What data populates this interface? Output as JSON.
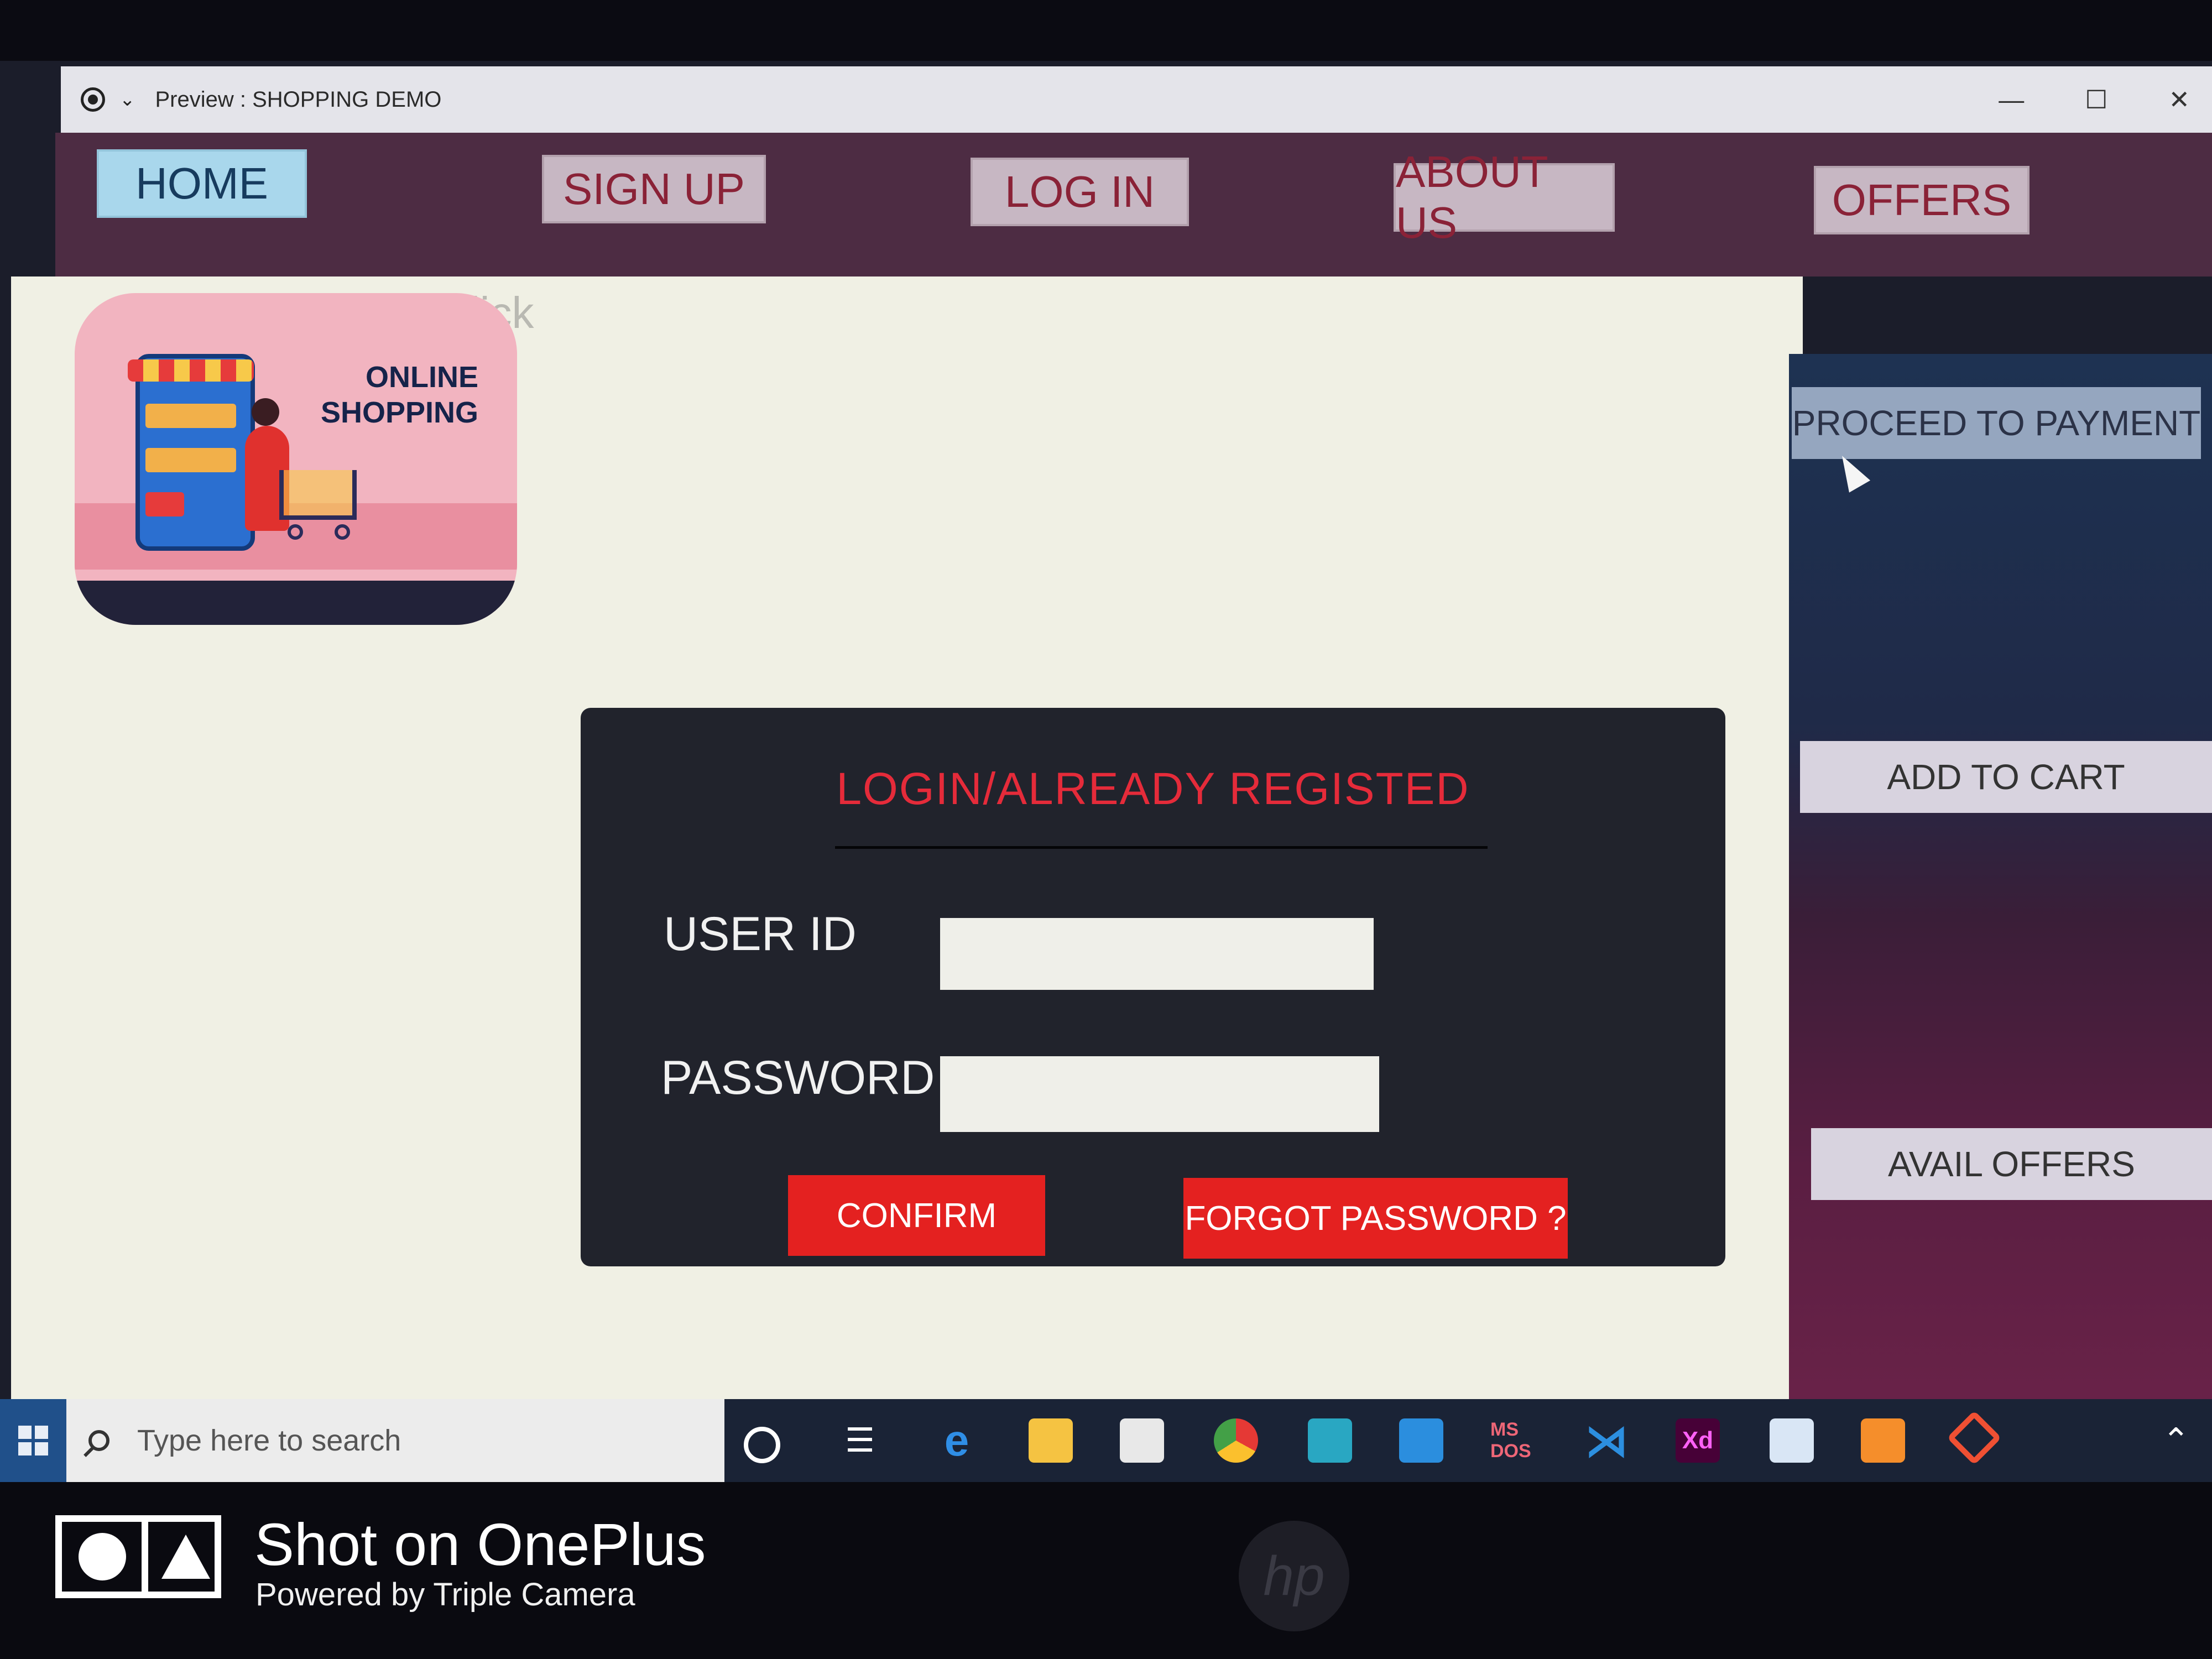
{
  "window": {
    "title": "Preview : SHOPPING DEMO",
    "minimize_label": "—",
    "maximize_label": "☐",
    "close_label": "✕"
  },
  "nav": {
    "items": [
      {
        "label": "HOME"
      },
      {
        "label": "SIGN UP"
      },
      {
        "label": "LOG IN"
      },
      {
        "label": "ABOUT US"
      },
      {
        "label": "OFFERS"
      }
    ]
  },
  "main": {
    "ghost_text": "lick",
    "logo_text": [
      "ONLINE",
      "SHOPPING"
    ]
  },
  "login": {
    "title": "LOGIN/ALREADY REGISTED",
    "user_id_label": "USER ID",
    "password_label": "PASSWORD",
    "user_id_value": "",
    "password_value": "",
    "confirm_label": "CONFIRM",
    "forgot_label": "FORGOT PASSWORD ?"
  },
  "side": {
    "proceed_label": "PROCEED TO PAYMENT",
    "add_cart_label": "ADD TO CART",
    "avail_offers_label": "AVAIL OFFERS"
  },
  "taskbar": {
    "search_placeholder": "Type here to search",
    "apps": [
      "cortana-icon",
      "task-view-icon",
      "edge-icon",
      "file-explorer-icon",
      "store-icon",
      "chrome-icon",
      "arduino-icon",
      "mail-icon",
      "ms-dos-icon",
      "vscode-icon",
      "adobe-xd-icon",
      "app-window-icon",
      "sublime-icon",
      "git-icon"
    ],
    "xd_label": "Xd",
    "msdos_label": "MS DOS"
  },
  "watermark": {
    "shot_on": "Shot on OnePlus",
    "powered": "Powered by Triple Camera",
    "brand": "hp"
  },
  "colors": {
    "nav_bg": "#4d2c43",
    "accent_red": "#e42120",
    "home_button": "#a9d7ec",
    "login_card": "#21232c"
  }
}
